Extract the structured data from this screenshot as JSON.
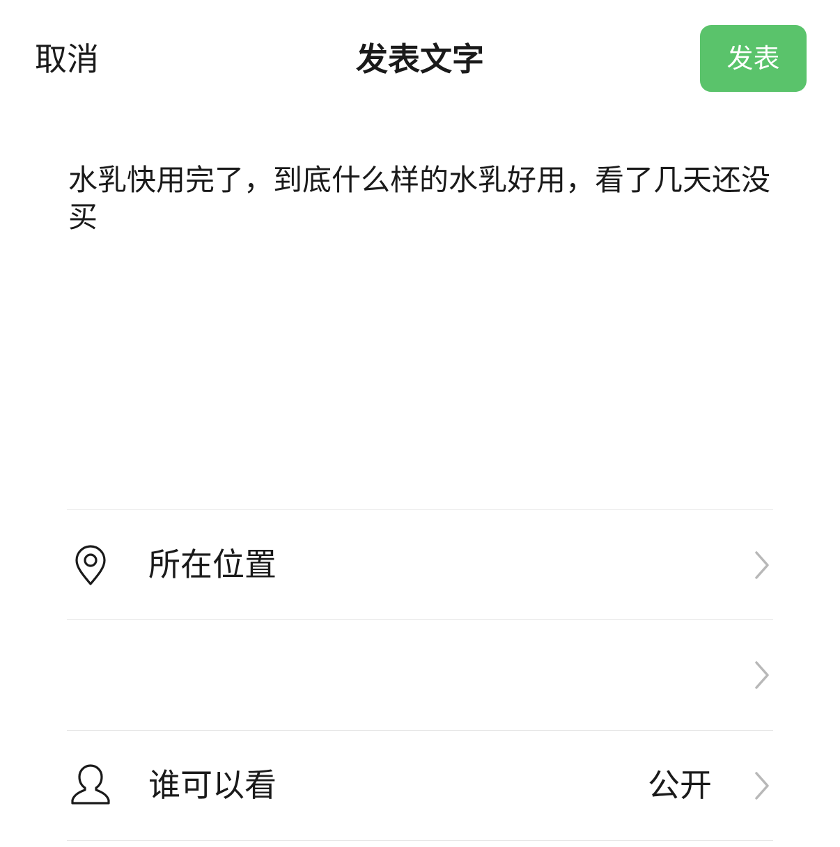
{
  "header": {
    "cancel_label": "取消",
    "title": "发表文字",
    "publish_label": "发表"
  },
  "post": {
    "text": "水乳快用完了，到底什么样的水乳好用，看了几天还没买"
  },
  "options": {
    "location": {
      "label": "所在位置",
      "icon": "location-pin-icon"
    },
    "blank": {
      "label": ""
    },
    "visibility": {
      "label": "谁可以看",
      "value": "公开",
      "icon": "person-icon"
    }
  },
  "colors": {
    "accent": "#5ac36b",
    "text": "#1a1a1a",
    "chevron": "#b8b8b8",
    "divider": "#e6e6e6"
  }
}
